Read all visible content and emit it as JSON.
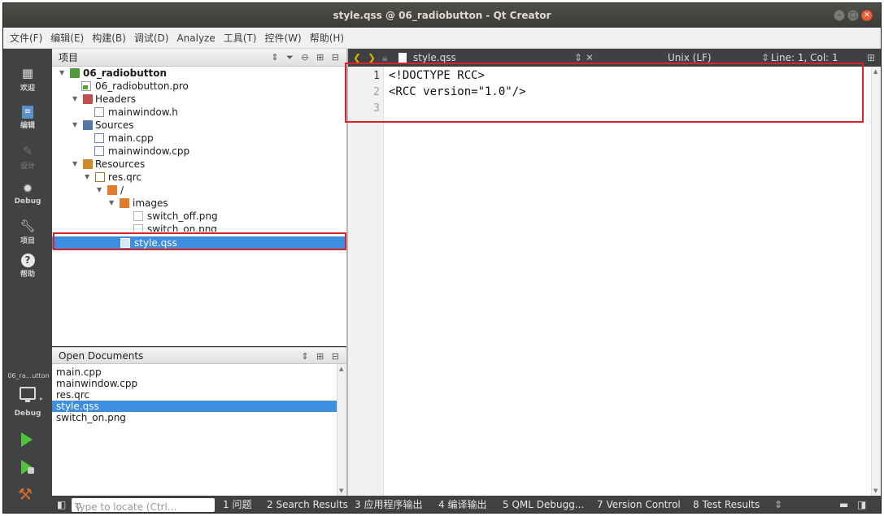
{
  "window": {
    "title": "style.qss @ 06_radiobutton - Qt Creator",
    "buttons": [
      "–",
      "□",
      "✕"
    ]
  },
  "menubar": [
    "文件(F)",
    "编辑(E)",
    "构建(B)",
    "调试(D)",
    "Analyze",
    "工具(T)",
    "控件(W)",
    "帮助(H)"
  ],
  "modes": [
    {
      "label": "欢迎",
      "icon": "welcome-grid-icon"
    },
    {
      "label": "编辑",
      "icon": "edit-doc-icon"
    },
    {
      "label": "设计",
      "icon": "design-pen-icon"
    },
    {
      "label": "Debug",
      "icon": "debug-bug-icon"
    },
    {
      "label": "项目",
      "icon": "projects-wrench-icon"
    },
    {
      "label": "帮助",
      "icon": "help-question-icon"
    }
  ],
  "kit": {
    "project_short": "06_ra...utton",
    "build_label": "Debug"
  },
  "project_panel": {
    "title": "项目",
    "tree": [
      {
        "label": "06_radiobutton",
        "bold": true
      },
      {
        "label": "06_radiobutton.pro"
      },
      {
        "label": "Headers"
      },
      {
        "label": "mainwindow.h"
      },
      {
        "label": "Sources"
      },
      {
        "label": "main.cpp"
      },
      {
        "label": "mainwindow.cpp"
      },
      {
        "label": "Resources"
      },
      {
        "label": "res.qrc"
      },
      {
        "label": "/"
      },
      {
        "label": "images"
      },
      {
        "label": "switch_off.png"
      },
      {
        "label": "switch_on.png"
      },
      {
        "label": "style.qss"
      }
    ]
  },
  "open_documents": {
    "title": "Open Documents",
    "items": [
      "main.cpp",
      "mainwindow.cpp",
      "res.qrc",
      "style.qss",
      "switch_on.png"
    ]
  },
  "editor": {
    "file_name": "style.qss",
    "line_ending": "Unix (LF)",
    "cursor": "Line: 1, Col: 1",
    "line_numbers": [
      "1",
      "2",
      "3"
    ],
    "lines": [
      "<!DOCTYPE RCC>",
      "<RCC version=\"1.0\"/>",
      ""
    ]
  },
  "statusbar": {
    "locate_placeholder": "Type to locate (Ctrl...",
    "panes": [
      "1 问题",
      "2 Search Results",
      "3 应用程序输出",
      "4 编译输出",
      "5 QML Debugg...",
      "7 Version Control",
      "8 Test Results"
    ]
  },
  "colors": {
    "selection": "#3d8ee0",
    "highlight_box": "#d8232a",
    "mode_bar": "#404244"
  }
}
